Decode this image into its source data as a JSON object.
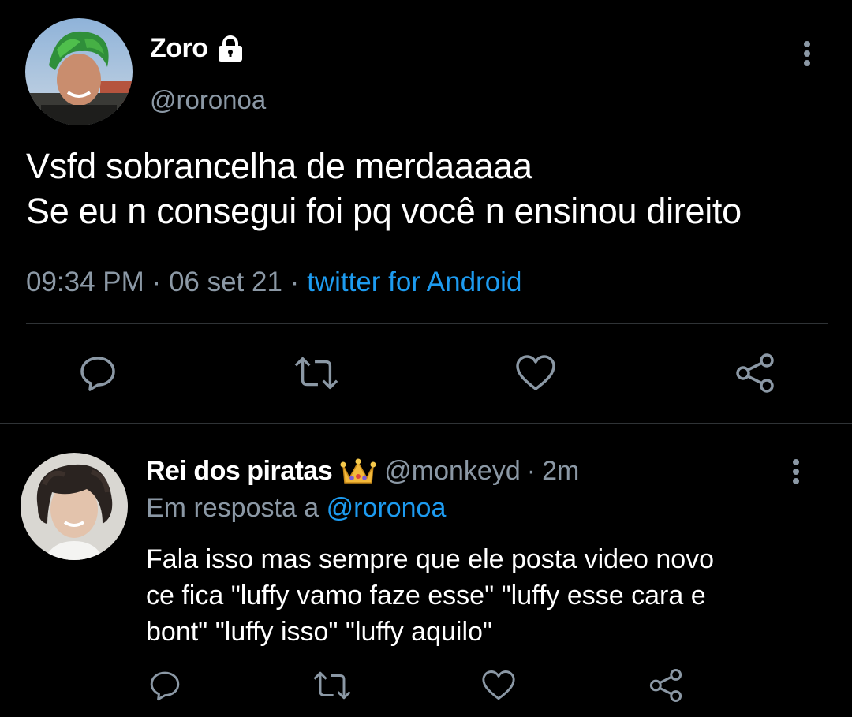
{
  "main_tweet": {
    "display_name": "Zoro",
    "handle": "@roronoa",
    "text_lines": [
      "Vsfd sobrancelha de merdaaaaa",
      "Se eu n consegui foi pq você n ensinou direito"
    ],
    "time": "09:34 PM",
    "date": "06 set 21",
    "source": "twitter for Android",
    "separator": "·"
  },
  "reply": {
    "display_name": "Rei dos piratas",
    "handle": "@monkeyd",
    "age": "2m",
    "separator": "·",
    "reply_prefix": "Em resposta a",
    "reply_mention": "@roronoa",
    "text_lines": [
      "Fala isso mas sempre que ele posta video novo",
      "ce fica \"luffy vamo faze esse\" \"luffy esse cara e",
      "bont\" \"luffy isso\" \"luffy aquilo\""
    ]
  },
  "icons": {
    "lock": "lock-icon",
    "crown": "crown-emoji",
    "more": "more-vertical-icon",
    "reply": "reply-icon",
    "retweet": "retweet-icon",
    "like": "heart-icon",
    "share": "share-icon"
  },
  "colors": {
    "background": "#000000",
    "text": "#ffffff",
    "muted": "#8b98a5",
    "link": "#1d9bf0",
    "divider": "#2f3336"
  }
}
